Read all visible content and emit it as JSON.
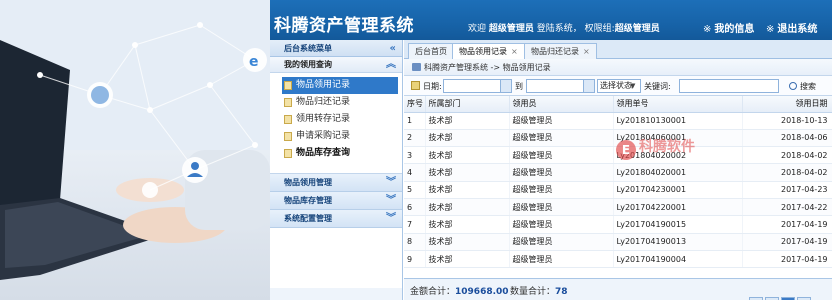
{
  "header": {
    "title": "科腾资产管理系统",
    "welcome_prefix": "欢迎",
    "user_name": "超级管理员",
    "login_text": "登陆系统，",
    "role_prefix": "权限组:",
    "role_name": "超级管理员",
    "my_info_label": "我的信息",
    "logout_label": "退出系统",
    "link_icon": "※"
  },
  "sidebar": {
    "title": "后台系统菜单",
    "section": "我的领用查询",
    "items": [
      {
        "label": "物品领用记录",
        "active": true
      },
      {
        "label": "物品归还记录"
      },
      {
        "label": "领用转存记录"
      },
      {
        "label": "申请采购记录"
      },
      {
        "label": "物品库存查询",
        "bold": true
      }
    ],
    "groups": [
      "物品领用管理",
      "物品库存管理",
      "系统配置管理"
    ]
  },
  "tabs": [
    {
      "label": "后台首页"
    },
    {
      "label": "物品领用记录",
      "active": true
    },
    {
      "label": "物品归还记录"
    }
  ],
  "breadcrumb": "科腾资产管理系统 -> 物品领用记录",
  "filters": {
    "date_label": "日期:",
    "to_label": "到",
    "status_select": "选择状态",
    "keyword_label": "关键词:",
    "search_label": "搜索"
  },
  "table": {
    "headers": [
      "序号",
      "所属部门",
      "领用员",
      "领用单号",
      "领用日期"
    ],
    "rows": [
      [
        "1",
        "技术部",
        "超级管理员",
        "Ly201810130001",
        "2018-10-13"
      ],
      [
        "2",
        "技术部",
        "超级管理员",
        "Ly201804060001",
        "2018-04-06"
      ],
      [
        "3",
        "技术部",
        "超级管理员",
        "Ly201804020002",
        "2018-04-02"
      ],
      [
        "4",
        "技术部",
        "超级管理员",
        "Ly201804020001",
        "2018-04-02"
      ],
      [
        "5",
        "技术部",
        "超级管理员",
        "Ly201704230001",
        "2017-04-23"
      ],
      [
        "6",
        "技术部",
        "超级管理员",
        "Ly201704220001",
        "2017-04-22"
      ],
      [
        "7",
        "技术部",
        "超级管理员",
        "Ly201704190015",
        "2017-04-19"
      ],
      [
        "8",
        "技术部",
        "超级管理员",
        "Ly201704190013",
        "2017-04-19"
      ],
      [
        "9",
        "技术部",
        "超级管理员",
        "Ly201704190004",
        "2017-04-19"
      ]
    ]
  },
  "footer": {
    "amount_label": "金额合计：",
    "amount_value": "109668.00",
    "qty_label": "数量合计：",
    "qty_value": "78"
  },
  "watermark": {
    "logo_text": "E",
    "text": "科腾软件"
  },
  "colors": {
    "header_blue": "#1763a8",
    "active_item": "#2f79c9",
    "total_value": "#1a4d9c"
  }
}
